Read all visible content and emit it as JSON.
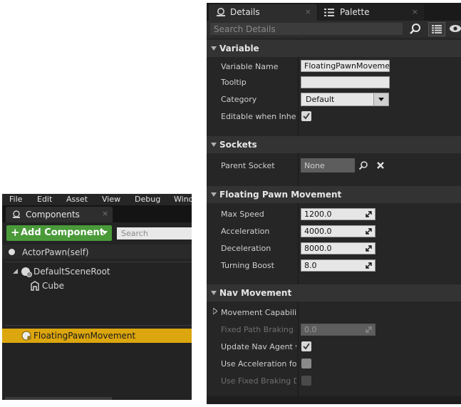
{
  "components_panel": {
    "menu": [
      "File",
      "Edit",
      "Asset",
      "View",
      "Debug",
      "Wind"
    ],
    "tab_label": "Components",
    "tab_close": "×",
    "add_button_label": "Add Component",
    "add_button_plus": "+",
    "search_placeholder": "Search",
    "actor_label": "ActorPawn(self)",
    "tree": [
      {
        "label": "DefaultSceneRoot",
        "icon": "scene-root-icon",
        "expanded": true
      },
      {
        "label": "Cube",
        "icon": "static-mesh-icon"
      },
      {
        "label": "FloatingPawnMovement",
        "icon": "movement-component-icon",
        "selected": true
      }
    ],
    "selection_color": "#dca60e",
    "add_button_color": "#4a9a3a"
  },
  "details_panel": {
    "tabs": [
      {
        "label": "Details",
        "icon": "magnifier-tab-icon",
        "close": "×",
        "active": true
      },
      {
        "label": "Palette",
        "icon": "palette-list-icon",
        "close": "×",
        "active": false
      }
    ],
    "search_placeholder": "Search Details",
    "categories": {
      "variable": {
        "title": "Variable",
        "variable_name_label": "Variable Name",
        "variable_name_value": "FloatingPawnMovement",
        "tooltip_label": "Tooltip",
        "tooltip_value": "",
        "category_label": "Category",
        "category_value": "Default",
        "editable_label": "Editable when Inherited",
        "editable_checked": true
      },
      "sockets": {
        "title": "Sockets",
        "parent_socket_label": "Parent Socket",
        "parent_socket_value": "None"
      },
      "floating": {
        "title": "Floating Pawn Movement",
        "max_speed_label": "Max Speed",
        "max_speed_value": "1200.0",
        "acceleration_label": "Acceleration",
        "acceleration_value": "4000.0",
        "deceleration_label": "Deceleration",
        "deceleration_value": "8000.0",
        "turning_boost_label": "Turning Boost",
        "turning_boost_value": "8.0"
      },
      "nav": {
        "title": "Nav Movement",
        "movement_capabilities_label": "Movement Capabilities",
        "fixed_path_label": "Fixed Path Braking Distance",
        "fixed_path_value": "0.0",
        "update_nav_label": "Update Nav Agent with Owners Collision",
        "update_nav_checked": true,
        "use_accel_label": "Use Acceleration for Paths",
        "use_accel_checked": false,
        "use_fixed_label": "Use Fixed Braking Distance for Paths",
        "use_fixed_checked": false
      }
    }
  }
}
